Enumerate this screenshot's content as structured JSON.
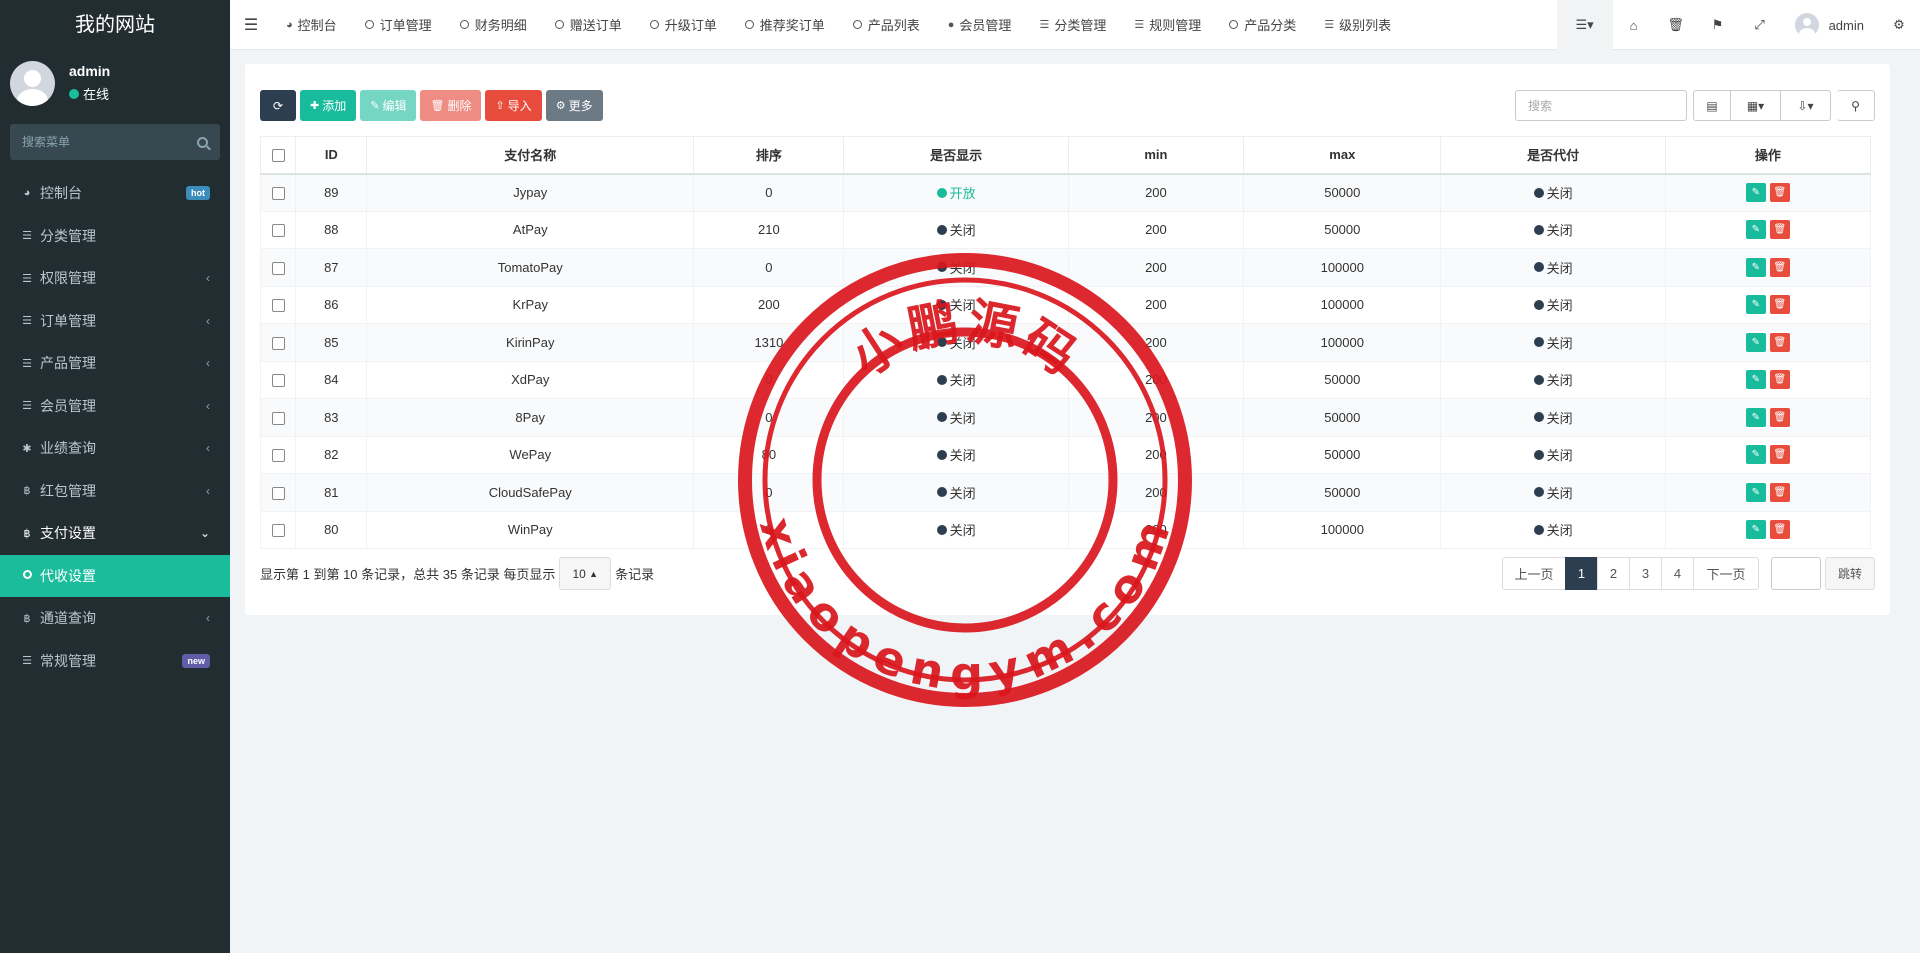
{
  "site_title": "我的网站",
  "user": {
    "name": "admin",
    "status": "在线"
  },
  "sidebar": {
    "search_placeholder": "搜索菜单",
    "items": [
      {
        "label": "控制台",
        "icon": "dashboard-icon",
        "badge": "hot"
      },
      {
        "label": "分类管理",
        "icon": "list-icon"
      },
      {
        "label": "权限管理",
        "icon": "list-icon"
      },
      {
        "label": "订单管理",
        "icon": "list-icon"
      },
      {
        "label": "产品管理",
        "icon": "list-icon"
      },
      {
        "label": "会员管理",
        "icon": "list-icon"
      },
      {
        "label": "业绩查询",
        "icon": "asterisk-icon"
      },
      {
        "label": "红包管理",
        "icon": "bitcoin-icon"
      },
      {
        "label": "支付设置",
        "icon": "bitcoin-icon"
      },
      {
        "label": "代收设置",
        "icon": "circle-icon"
      },
      {
        "label": "通道查询",
        "icon": "bitcoin-icon"
      },
      {
        "label": "常规管理",
        "icon": "list-icon",
        "badge": "new"
      }
    ]
  },
  "topbar": {
    "tabs": [
      {
        "label": "控制台",
        "icon": "dashboard-icon"
      },
      {
        "label": "订单管理",
        "icon": "circle-icon"
      },
      {
        "label": "财务明细",
        "icon": "circle-icon"
      },
      {
        "label": "赠送订单",
        "icon": "circle-icon"
      },
      {
        "label": "升级订单",
        "icon": "circle-icon"
      },
      {
        "label": "推荐奖订单",
        "icon": "circle-icon"
      },
      {
        "label": "产品列表",
        "icon": "circle-icon"
      },
      {
        "label": "会员管理",
        "icon": "user-icon"
      },
      {
        "label": "分类管理",
        "icon": "list-icon"
      },
      {
        "label": "规则管理",
        "icon": "list-icon"
      },
      {
        "label": "产品分类",
        "icon": "circle-icon"
      },
      {
        "label": "级别列表",
        "icon": "list-icon"
      }
    ],
    "user_name": "admin"
  },
  "toolbar": {
    "add": "添加",
    "edit": "编辑",
    "delete": "删除",
    "import": "导入",
    "more": "更多",
    "search_placeholder": "搜索"
  },
  "table": {
    "columns": [
      "ID",
      "支付名称",
      "排序",
      "是否显示",
      "min",
      "max",
      "是否代付",
      "操作"
    ],
    "rows": [
      {
        "id": "89",
        "name": "Jypay",
        "sort": "0",
        "show": "开放",
        "show_on": true,
        "min": "200",
        "max": "50000",
        "payout": "关闭"
      },
      {
        "id": "88",
        "name": "AtPay",
        "sort": "210",
        "show": "关闭",
        "show_on": false,
        "min": "200",
        "max": "50000",
        "payout": "关闭"
      },
      {
        "id": "87",
        "name": "TomatoPay",
        "sort": "0",
        "show": "关闭",
        "show_on": false,
        "min": "200",
        "max": "100000",
        "payout": "关闭"
      },
      {
        "id": "86",
        "name": "KrPay",
        "sort": "200",
        "show": "关闭",
        "show_on": false,
        "min": "200",
        "max": "100000",
        "payout": "关闭"
      },
      {
        "id": "85",
        "name": "KirinPay",
        "sort": "1310",
        "show": "关闭",
        "show_on": false,
        "min": "200",
        "max": "100000",
        "payout": "关闭"
      },
      {
        "id": "84",
        "name": "XdPay",
        "sort": "0",
        "show": "关闭",
        "show_on": false,
        "min": "200",
        "max": "50000",
        "payout": "关闭"
      },
      {
        "id": "83",
        "name": "8Pay",
        "sort": "0",
        "show": "关闭",
        "show_on": false,
        "min": "200",
        "max": "50000",
        "payout": "关闭"
      },
      {
        "id": "82",
        "name": "WePay",
        "sort": "80",
        "show": "关闭",
        "show_on": false,
        "min": "200",
        "max": "50000",
        "payout": "关闭"
      },
      {
        "id": "81",
        "name": "CloudSafePay",
        "sort": "0",
        "show": "关闭",
        "show_on": false,
        "min": "200",
        "max": "50000",
        "payout": "关闭"
      },
      {
        "id": "80",
        "name": "WinPay",
        "sort": "0",
        "show": "关闭",
        "show_on": false,
        "min": "200",
        "max": "100000",
        "payout": "关闭"
      }
    ]
  },
  "pagination": {
    "info_prefix": "显示第 1 到第 10 条记录，总共 35 条记录 每页显示",
    "page_size": "10",
    "info_suffix": "条记录",
    "prev": "上一页",
    "pages": [
      "1",
      "2",
      "3",
      "4"
    ],
    "active_page": "1",
    "next": "下一页",
    "goto": "跳转"
  },
  "watermark": {
    "top_text": "小鹏源码",
    "bottom_text": "xiaopengym.com",
    "color": "#d9161c"
  }
}
